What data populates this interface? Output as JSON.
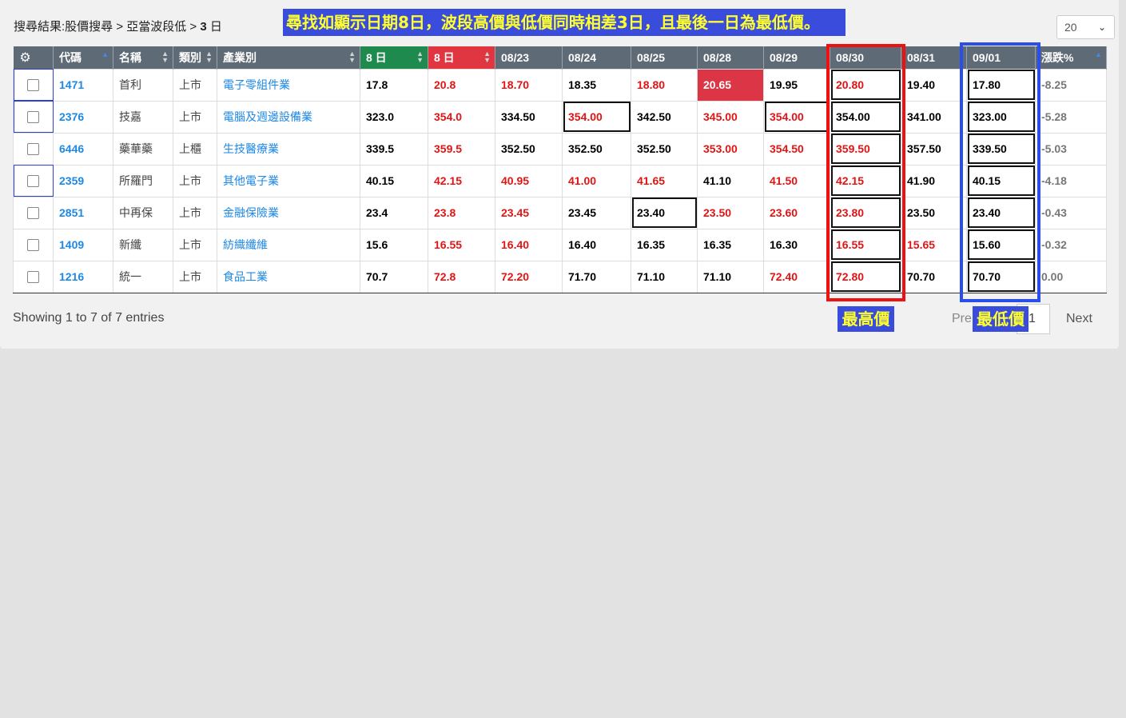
{
  "breadcrumb": {
    "prefix": "搜尋結果:股價搜尋 > 亞當波段低 > ",
    "days": "3",
    "unit": " 日"
  },
  "banner": "尋找如顯示日期8日，波段高價與低價同時相差3日，且最後一日為最低價。",
  "page_size": "20",
  "columns": [
    "代碼",
    "名稱",
    "類別",
    "產業別",
    "8 日",
    "8 日",
    "08/23",
    "08/24",
    "08/25",
    "08/28",
    "08/29",
    "08/30",
    "08/31",
    "09/01",
    "漲跌%"
  ],
  "rows": [
    {
      "code": "1471",
      "name": "首利",
      "market": "上市",
      "industry": "電子零組件業",
      "low8": "17.8",
      "high8": "20.8",
      "d0823": "18.70",
      "d0824": "18.35",
      "d0825": "18.80",
      "d0828": "20.65",
      "d0829": "19.95",
      "d0830": "20.80",
      "d0831": "19.40",
      "d0901": "17.80",
      "chg": "-8.25"
    },
    {
      "code": "2376",
      "name": "技嘉",
      "market": "上市",
      "industry": "電腦及週邊設備業",
      "low8": "323.0",
      "high8": "354.0",
      "d0823": "334.50",
      "d0824": "354.00",
      "d0825": "342.50",
      "d0828": "345.00",
      "d0829": "354.00",
      "d0830": "354.00",
      "d0831": "341.00",
      "d0901": "323.00",
      "chg": "-5.28"
    },
    {
      "code": "6446",
      "name": "藥華藥",
      "market": "上櫃",
      "industry": "生技醫療業",
      "low8": "339.5",
      "high8": "359.5",
      "d0823": "352.50",
      "d0824": "352.50",
      "d0825": "352.50",
      "d0828": "353.00",
      "d0829": "354.50",
      "d0830": "359.50",
      "d0831": "357.50",
      "d0901": "339.50",
      "chg": "-5.03"
    },
    {
      "code": "2359",
      "name": "所羅門",
      "market": "上市",
      "industry": "其他電子業",
      "low8": "40.15",
      "high8": "42.15",
      "d0823": "40.95",
      "d0824": "41.00",
      "d0825": "41.65",
      "d0828": "41.10",
      "d0829": "41.50",
      "d0830": "42.15",
      "d0831": "41.90",
      "d0901": "40.15",
      "chg": "-4.18"
    },
    {
      "code": "2851",
      "name": "中再保",
      "market": "上市",
      "industry": "金融保險業",
      "low8": "23.4",
      "high8": "23.8",
      "d0823": "23.45",
      "d0824": "23.45",
      "d0825": "23.40",
      "d0828": "23.50",
      "d0829": "23.60",
      "d0830": "23.80",
      "d0831": "23.50",
      "d0901": "23.40",
      "chg": "-0.43"
    },
    {
      "code": "1409",
      "name": "新纖",
      "market": "上市",
      "industry": "紡織纖維",
      "low8": "15.6",
      "high8": "16.55",
      "d0823": "16.40",
      "d0824": "16.40",
      "d0825": "16.35",
      "d0828": "16.35",
      "d0829": "16.30",
      "d0830": "16.55",
      "d0831": "15.65",
      "d0901": "15.60",
      "chg": "-0.32"
    },
    {
      "code": "1216",
      "name": "統一",
      "market": "上市",
      "industry": "食品工業",
      "low8": "70.7",
      "high8": "72.8",
      "d0823": "72.20",
      "d0824": "71.70",
      "d0825": "71.10",
      "d0828": "71.10",
      "d0829": "72.40",
      "d0830": "72.80",
      "d0831": "70.70",
      "d0901": "70.70",
      "chg": "0.00"
    }
  ],
  "annotations": {
    "high_label": "最高價",
    "low_label": "最低價"
  },
  "footer": {
    "info": "Showing 1 to 7 of 7 entries",
    "prev": "Pre",
    "page": "1",
    "next": "Next"
  }
}
